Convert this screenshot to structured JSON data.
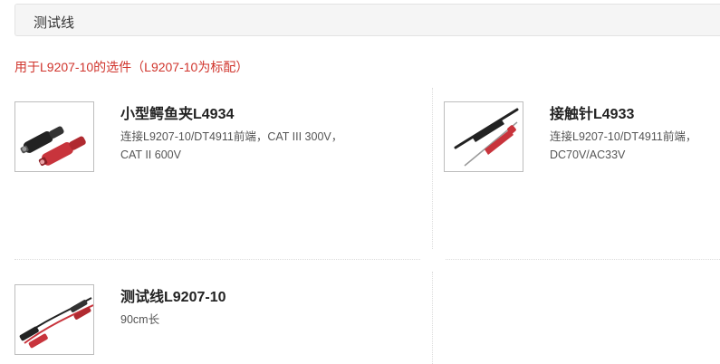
{
  "section": {
    "title": "测试线"
  },
  "subtitle": "用于L9207-10的选件（L9207-10为标配）",
  "products": [
    {
      "name": "小型鳄鱼夹L4934",
      "description": "连接L9207-10/DT4911前端，CAT III 300V，CAT II 600V"
    },
    {
      "name": "接触针L4933",
      "description": "连接L9207-10/DT4911前端，DC70V/AC33V"
    },
    {
      "name": "测试线L9207-10",
      "description": "90cm长"
    }
  ],
  "colors": {
    "accent_red": "#d0342c",
    "probe_red": "#c8343c",
    "probe_black": "#222222"
  }
}
